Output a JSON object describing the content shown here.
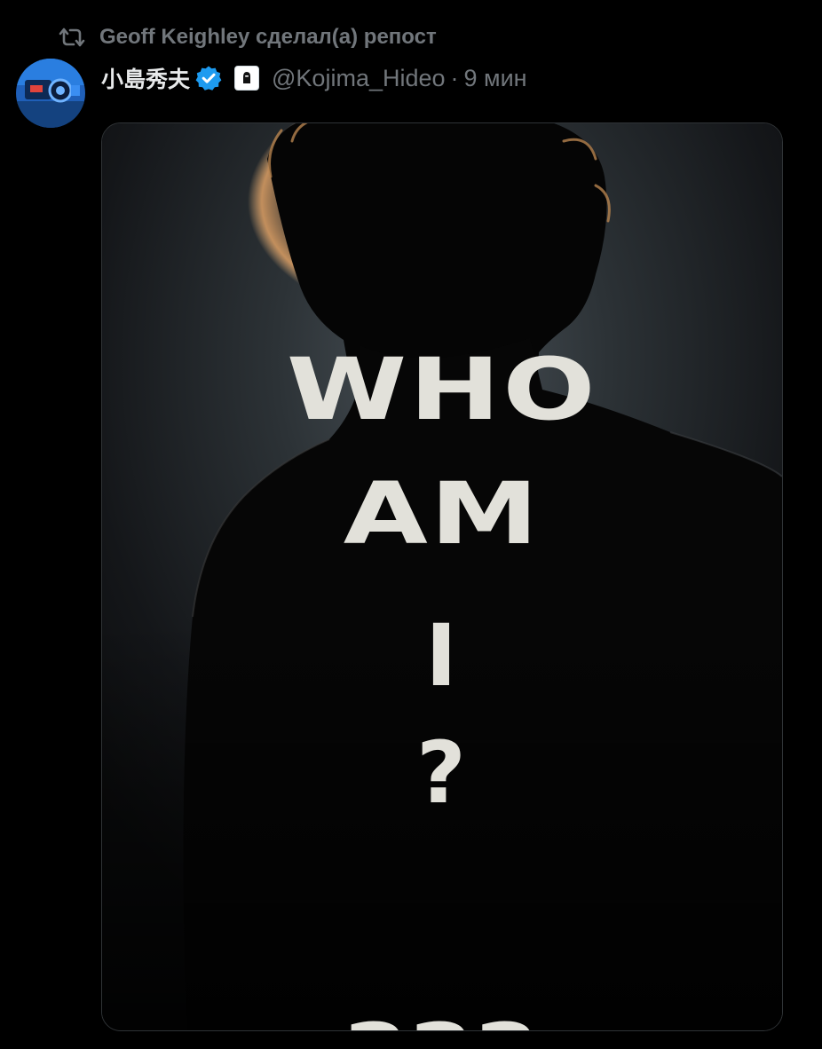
{
  "repost": {
    "icon": "repost-icon",
    "text": "Geoff Keighley сделал(а) репост"
  },
  "author": {
    "display_name": "小島秀夫",
    "verified_icon": "verified-badge-icon",
    "verified_color": "#1d9bf0",
    "affiliate_badge": "kojima-productions-logo",
    "handle": "@Kojima_Hideo",
    "separator": "·",
    "time": "9 мин"
  },
  "media": {
    "poster_lines": [
      "WHO",
      "AM",
      "I",
      "?",
      "???"
    ],
    "text_color": "#e2e1da"
  }
}
